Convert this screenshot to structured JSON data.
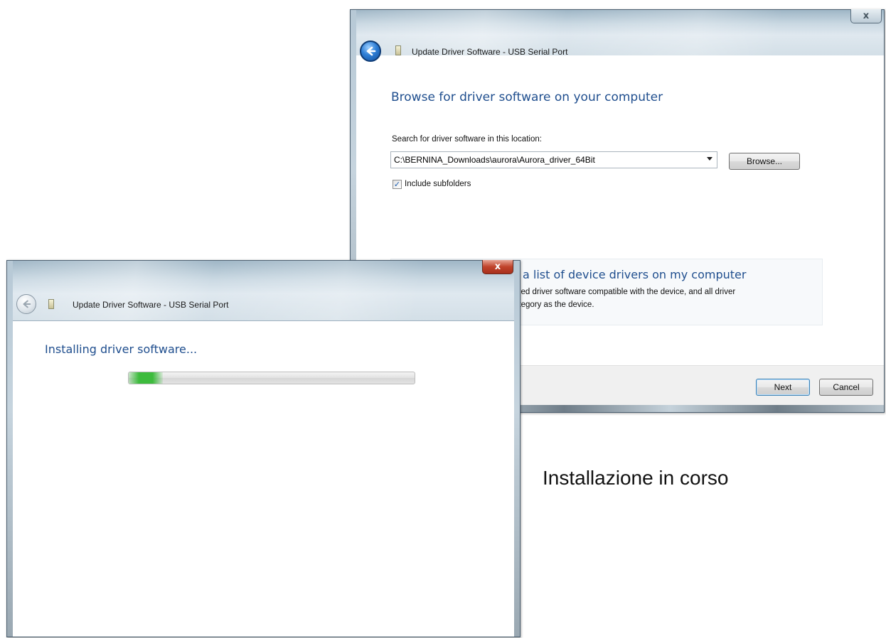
{
  "back_window": {
    "title": "Update Driver Software - USB Serial Port",
    "close_glyph": "x",
    "heading": "Browse for driver software on your computer",
    "search_label": "Search for driver software in this location:",
    "path_value": "C:\\BERNINA_Downloads\\aurora\\Aurora_driver_64Bit",
    "browse_label": "Browse...",
    "include_subfolders_label": "Include subfolders",
    "include_subfolders_checked": true,
    "pick_option_title": "a list of device drivers on my computer",
    "pick_option_desc_1": "alled driver software compatible with the device, and all driver",
    "pick_option_desc_2": "ategory as the device.",
    "next_label": "Next",
    "cancel_label": "Cancel"
  },
  "front_window": {
    "title": "Update Driver Software - USB Serial Port",
    "close_glyph": "x",
    "heading": "Installing driver software...",
    "progress_fraction": 0.12
  },
  "caption": "Installazione in corso",
  "icons": {
    "back": "back-arrow-icon",
    "device": "usb-device-icon",
    "close": "close-icon",
    "checkbox": "checkmark-icon",
    "dropdown": "chevron-down-icon"
  },
  "colors": {
    "heading_blue": "#1f4e8e",
    "progress_green": "#3dbb3d",
    "close_red": "#c0432b"
  }
}
